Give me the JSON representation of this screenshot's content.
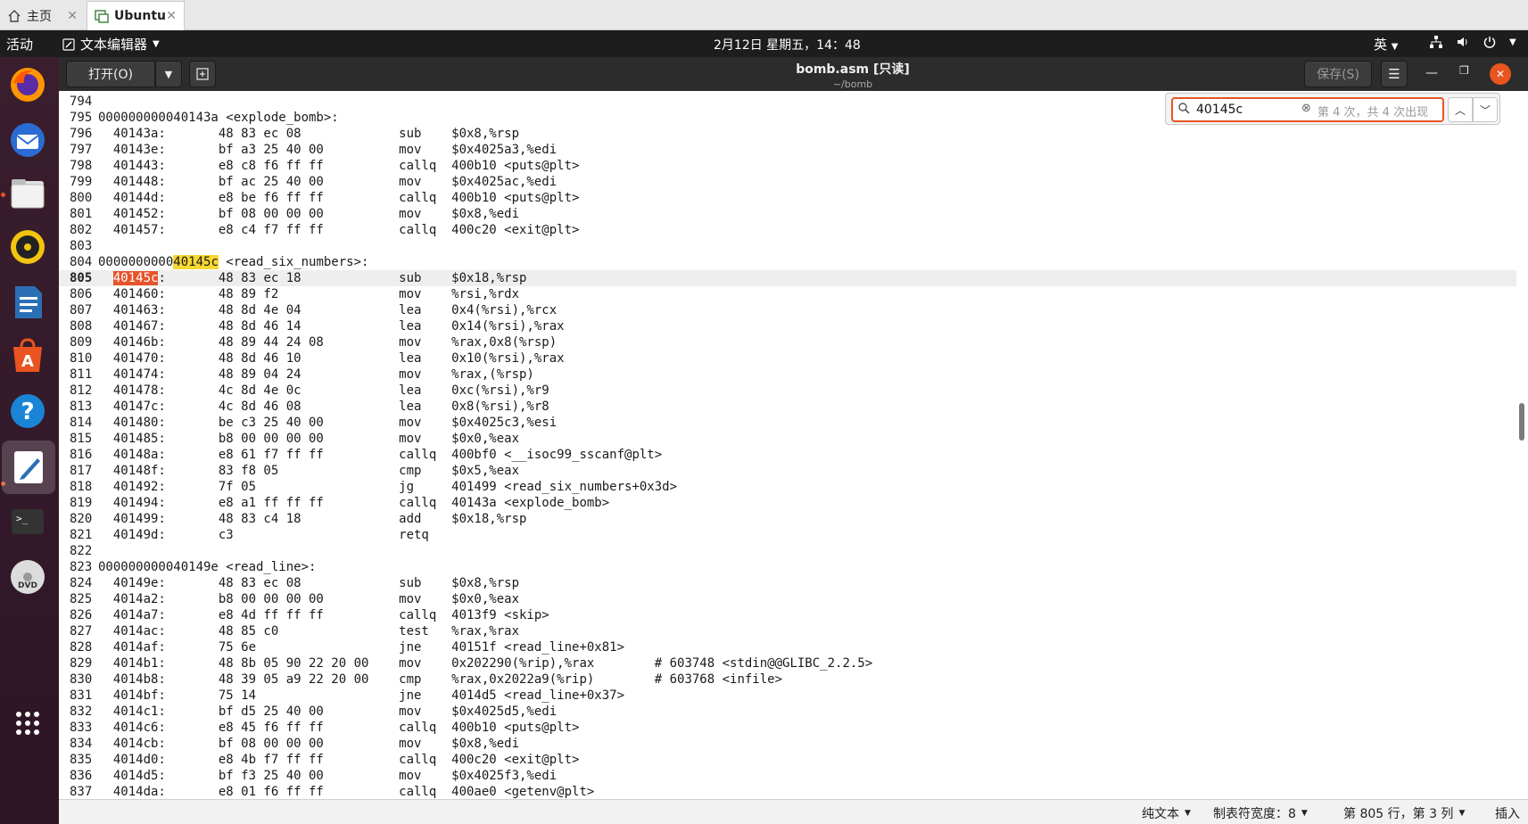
{
  "vm_tabs": {
    "home_label": "主页",
    "ubuntu_label": "Ubuntu",
    "close_glyph": "✕"
  },
  "topbar": {
    "activities": "活动",
    "app_menu": "文本编辑器",
    "clock": "2月12日 星期五，14：48",
    "ime": "英"
  },
  "header": {
    "open_label": "打开(O)",
    "title": "bomb.asm [只读]",
    "subtitle": "~/bomb",
    "save_label": "保存(S)"
  },
  "search": {
    "query": "40145c",
    "match_status": "第 4 次，共 4 次出现"
  },
  "editor": {
    "current_line": 805,
    "lines": [
      {
        "n": "794",
        "text": ""
      },
      {
        "n": "795",
        "text": "000000000040143a <explode_bomb>:"
      },
      {
        "n": "796",
        "text": "  40143a:\t48 83 ec 08          \tsub    $0x8,%rsp"
      },
      {
        "n": "797",
        "text": "  40143e:\tbf a3 25 40 00       \tmov    $0x4025a3,%edi"
      },
      {
        "n": "798",
        "text": "  401443:\te8 c8 f6 ff ff       \tcallq  400b10 <puts@plt>"
      },
      {
        "n": "799",
        "text": "  401448:\tbf ac 25 40 00       \tmov    $0x4025ac,%edi"
      },
      {
        "n": "800",
        "text": "  40144d:\te8 be f6 ff ff       \tcallq  400b10 <puts@plt>"
      },
      {
        "n": "801",
        "text": "  401452:\tbf 08 00 00 00       \tmov    $0x8,%edi"
      },
      {
        "n": "802",
        "text": "  401457:\te8 c4 f7 ff ff       \tcallq  400c20 <exit@plt>"
      },
      {
        "n": "803",
        "text": ""
      },
      {
        "n": "804",
        "pre": "0000000000",
        "match": "40145c",
        "post": " <read_six_numbers>:"
      },
      {
        "n": "805",
        "pre": "  ",
        "current_match": "40145c",
        "post": ":\t48 83 ec 18          \tsub    $0x18,%rsp"
      },
      {
        "n": "806",
        "text": "  401460:\t48 89 f2             \tmov    %rsi,%rdx"
      },
      {
        "n": "807",
        "text": "  401463:\t48 8d 4e 04          \tlea    0x4(%rsi),%rcx"
      },
      {
        "n": "808",
        "text": "  401467:\t48 8d 46 14          \tlea    0x14(%rsi),%rax"
      },
      {
        "n": "809",
        "text": "  40146b:\t48 89 44 24 08       \tmov    %rax,0x8(%rsp)"
      },
      {
        "n": "810",
        "text": "  401470:\t48 8d 46 10          \tlea    0x10(%rsi),%rax"
      },
      {
        "n": "811",
        "text": "  401474:\t48 89 04 24          \tmov    %rax,(%rsp)"
      },
      {
        "n": "812",
        "text": "  401478:\t4c 8d 4e 0c          \tlea    0xc(%rsi),%r9"
      },
      {
        "n": "813",
        "text": "  40147c:\t4c 8d 46 08          \tlea    0x8(%rsi),%r8"
      },
      {
        "n": "814",
        "text": "  401480:\tbe c3 25 40 00       \tmov    $0x4025c3,%esi"
      },
      {
        "n": "815",
        "text": "  401485:\tb8 00 00 00 00       \tmov    $0x0,%eax"
      },
      {
        "n": "816",
        "text": "  40148a:\te8 61 f7 ff ff       \tcallq  400bf0 <__isoc99_sscanf@plt>"
      },
      {
        "n": "817",
        "text": "  40148f:\t83 f8 05             \tcmp    $0x5,%eax"
      },
      {
        "n": "818",
        "text": "  401492:\t7f 05                \tjg     401499 <read_six_numbers+0x3d>"
      },
      {
        "n": "819",
        "text": "  401494:\te8 a1 ff ff ff       \tcallq  40143a <explode_bomb>"
      },
      {
        "n": "820",
        "text": "  401499:\t48 83 c4 18          \tadd    $0x18,%rsp"
      },
      {
        "n": "821",
        "text": "  40149d:\tc3                   \tretq   "
      },
      {
        "n": "822",
        "text": ""
      },
      {
        "n": "823",
        "text": "000000000040149e <read_line>:"
      },
      {
        "n": "824",
        "text": "  40149e:\t48 83 ec 08          \tsub    $0x8,%rsp"
      },
      {
        "n": "825",
        "text": "  4014a2:\tb8 00 00 00 00       \tmov    $0x0,%eax"
      },
      {
        "n": "826",
        "text": "  4014a7:\te8 4d ff ff ff       \tcallq  4013f9 <skip>"
      },
      {
        "n": "827",
        "text": "  4014ac:\t48 85 c0             \ttest   %rax,%rax"
      },
      {
        "n": "828",
        "text": "  4014af:\t75 6e                \tjne    40151f <read_line+0x81>"
      },
      {
        "n": "829",
        "text": "  4014b1:\t48 8b 05 90 22 20 00 \tmov    0x202290(%rip),%rax        # 603748 <stdin@@GLIBC_2.2.5>"
      },
      {
        "n": "830",
        "text": "  4014b8:\t48 39 05 a9 22 20 00 \tcmp    %rax,0x2022a9(%rip)        # 603768 <infile>"
      },
      {
        "n": "831",
        "text": "  4014bf:\t75 14                \tjne    4014d5 <read_line+0x37>"
      },
      {
        "n": "832",
        "text": "  4014c1:\tbf d5 25 40 00       \tmov    $0x4025d5,%edi"
      },
      {
        "n": "833",
        "text": "  4014c6:\te8 45 f6 ff ff       \tcallq  400b10 <puts@plt>"
      },
      {
        "n": "834",
        "text": "  4014cb:\tbf 08 00 00 00       \tmov    $0x8,%edi"
      },
      {
        "n": "835",
        "text": "  4014d0:\te8 4b f7 ff ff       \tcallq  400c20 <exit@plt>"
      },
      {
        "n": "836",
        "text": "  4014d5:\tbf f3 25 40 00       \tmov    $0x4025f3,%edi"
      },
      {
        "n": "837",
        "text": "  4014da:\te8 01 f6 ff ff       \tcallq  400ae0 <getenv@plt>"
      }
    ]
  },
  "statusbar": {
    "language": "纯文本",
    "tab_width": "制表符宽度：8",
    "position": "第 805 行，第 3 列",
    "mode": "插入"
  },
  "colors": {
    "accent": "#e95420",
    "match_highlight": "#f7d731",
    "current_match_highlight": "#e8542c"
  },
  "dock_icons": [
    "firefox-icon",
    "thunderbird-icon",
    "files-icon",
    "rhythmbox-icon",
    "libreoffice-writer-icon",
    "ubuntu-software-icon",
    "help-icon",
    "text-editor-icon",
    "terminal-icon",
    "dvd-icon",
    "show-apps-icon"
  ]
}
